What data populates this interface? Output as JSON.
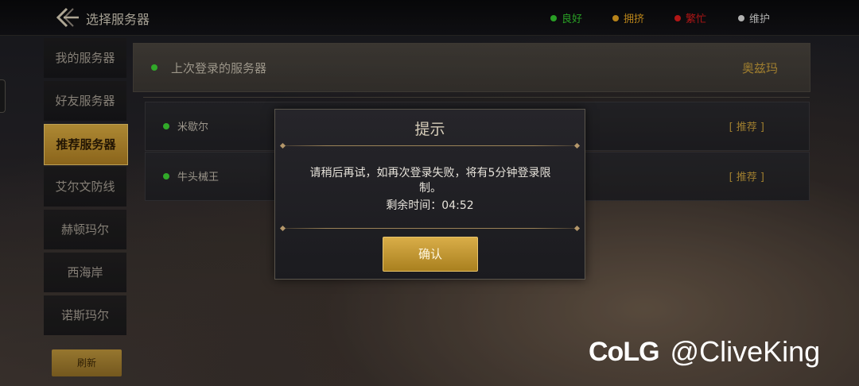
{
  "header": {
    "title": "选择服务器",
    "legend": [
      {
        "label": "良好",
        "color": "#33c22e"
      },
      {
        "label": "拥挤",
        "color": "#e0a020"
      },
      {
        "label": "繁忙",
        "color": "#d81c1c"
      },
      {
        "label": "维护",
        "color": "#d8d8d8"
      }
    ]
  },
  "sidebar": {
    "items": [
      {
        "label": "我的服务器"
      },
      {
        "label": "好友服务器"
      },
      {
        "label": "推荐服务器"
      },
      {
        "label": "艾尔文防线"
      },
      {
        "label": "赫顿玛尔"
      },
      {
        "label": "西海岸"
      },
      {
        "label": "诺斯玛尔"
      }
    ],
    "active_label": "推荐服务器",
    "bottom_button": "刷新"
  },
  "main": {
    "last_login_label": "上次登录的服务器",
    "last_login_server": "奥兹玛",
    "servers": [
      {
        "name": "米歇尔",
        "tag": "[ 推荐 ]",
        "status_color": "#33c22e"
      },
      {
        "name": "牛头械王",
        "tag": "[ 推荐 ]",
        "status_color": "#33c22e"
      }
    ]
  },
  "dialog": {
    "title": "提示",
    "message": "请稍后再试，如再次登录失败，将有5分钟登录限制。",
    "timer_label": "剩余时间：04:52",
    "confirm_label": "确认"
  },
  "watermark": {
    "logo": "CoLG",
    "handle": "@CliveKing"
  }
}
